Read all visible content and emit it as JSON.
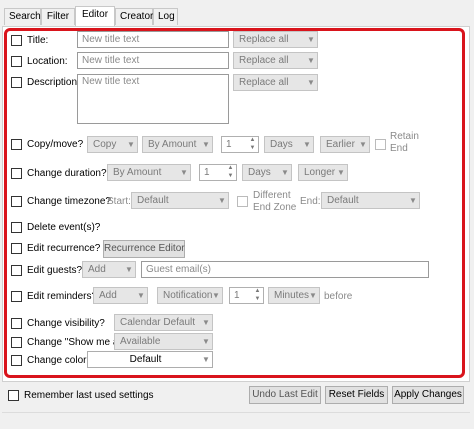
{
  "tabs": [
    {
      "label": "Search"
    },
    {
      "label": "Filter"
    },
    {
      "label": "Editor"
    },
    {
      "label": "Creator"
    },
    {
      "label": "Log"
    }
  ],
  "active_tab": "Editor",
  "title_row": {
    "label": "Title:",
    "placeholder": "New title text",
    "mode": "Replace all"
  },
  "location_row": {
    "label": "Location:",
    "placeholder": "New title text",
    "mode": "Replace all"
  },
  "description_row": {
    "label": "Description:",
    "placeholder": "New title text",
    "mode": "Replace all"
  },
  "copy_move": {
    "label": "Copy/move?",
    "action": "Copy",
    "by": "By Amount",
    "amount": "1",
    "unit": "Days",
    "direction": "Earlier",
    "retain_label_1": "Retain",
    "retain_label_2": "End"
  },
  "duration": {
    "label": "Change duration?",
    "by": "By Amount",
    "amount": "1",
    "unit": "Days",
    "direction": "Longer"
  },
  "timezone": {
    "label": "Change timezone?",
    "start_label": "Start:",
    "start_value": "Default",
    "different_end_1": "Different",
    "different_end_2": "End Zone",
    "end_label": "End:",
    "end_value": "Default"
  },
  "delete": {
    "label": "Delete event(s)?"
  },
  "recurrence": {
    "label": "Edit recurrence?",
    "button": "Recurrence Editor"
  },
  "guests": {
    "label": "Edit guests?",
    "action": "Add",
    "placeholder": "Guest email(s)"
  },
  "reminders": {
    "label": "Edit reminders?",
    "action": "Add",
    "type": "Notification",
    "amount": "1",
    "unit": "Minutes",
    "suffix": "before"
  },
  "visibility": {
    "label": "Change visibility?",
    "value": "Calendar Default"
  },
  "show_me_as": {
    "label": "Change \"Show me as\"?",
    "value": "Available"
  },
  "color": {
    "label": "Change color?",
    "value": "Default"
  },
  "footer": {
    "remember_label": "Remember last used settings",
    "undo_label": "Undo Last Edit",
    "reset_label": "Reset Fields",
    "apply_label": "Apply Changes"
  },
  "colors": {
    "highlight_border": "#d9141c",
    "panel_bg": "#ffffff",
    "window_bg": "#f0f0f0"
  }
}
